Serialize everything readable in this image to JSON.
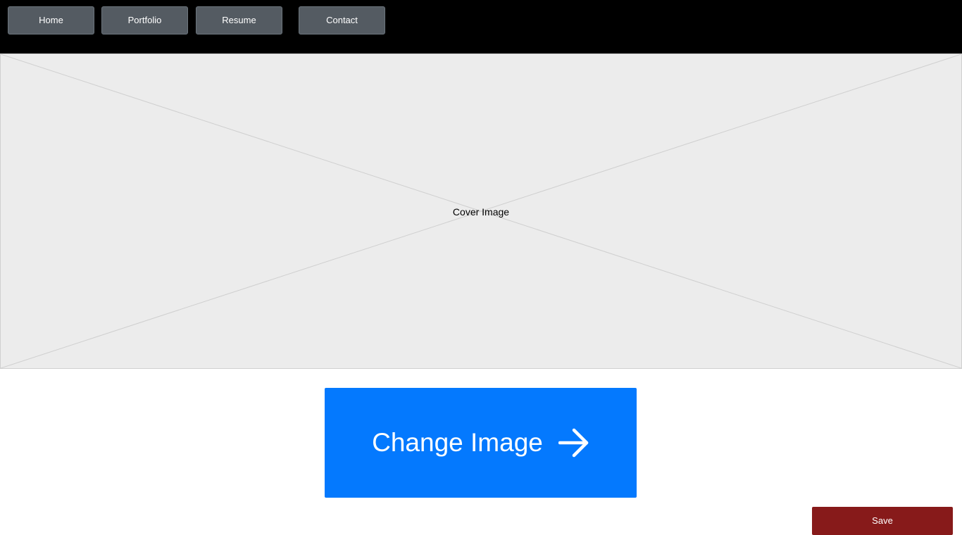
{
  "nav": {
    "items": [
      {
        "label": "Home"
      },
      {
        "label": "Portfolio"
      },
      {
        "label": "Resume"
      },
      {
        "label": "Contact"
      }
    ]
  },
  "cover": {
    "label": "Cover Image"
  },
  "change_button": {
    "label": "Change Image",
    "icon": "arrow-right-icon"
  },
  "save_button": {
    "label": "Save"
  },
  "colors": {
    "nav_background": "#000000",
    "nav_button": "#545b62",
    "primary": "#0479fe",
    "save": "#871a1a",
    "placeholder": "#ececec"
  }
}
